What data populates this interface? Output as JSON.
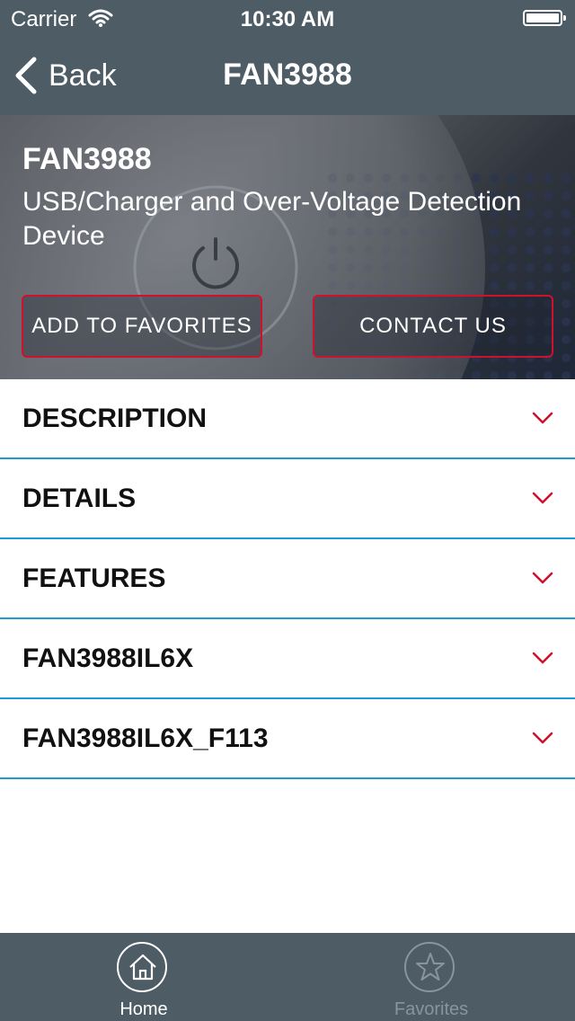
{
  "status_bar": {
    "carrier": "Carrier",
    "time": "10:30 AM"
  },
  "nav": {
    "back_label": "Back",
    "title": "FAN3988"
  },
  "hero": {
    "part_name": "FAN3988",
    "description": "USB/Charger and Over-Voltage Detection Device",
    "add_favorites_label": "ADD TO FAVORITES",
    "contact_label": "CONTACT US"
  },
  "sections": [
    {
      "label": "DESCRIPTION"
    },
    {
      "label": "DETAILS"
    },
    {
      "label": "FEATURES"
    },
    {
      "label": "FAN3988IL6X"
    },
    {
      "label": "FAN3988IL6X_F113"
    }
  ],
  "tabs": [
    {
      "label": "Home",
      "icon": "home-icon",
      "active": true
    },
    {
      "label": "Favorites",
      "icon": "star-icon",
      "active": false
    }
  ],
  "colors": {
    "bar": "#4e5c66",
    "accent_red": "#d0102d",
    "divider_blue": "#1e9bd7"
  }
}
